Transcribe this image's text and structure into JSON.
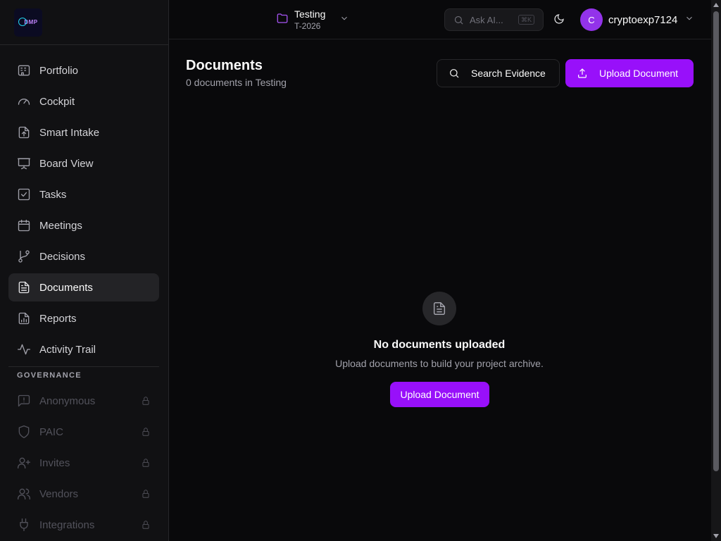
{
  "logo": {
    "text": "DMP"
  },
  "sidebar": {
    "items": [
      {
        "label": "Portfolio",
        "icon": "building-icon"
      },
      {
        "label": "Cockpit",
        "icon": "gauge-icon"
      },
      {
        "label": "Smart Intake",
        "icon": "file-upload-icon"
      },
      {
        "label": "Board View",
        "icon": "presentation-icon"
      },
      {
        "label": "Tasks",
        "icon": "checkbox-icon"
      },
      {
        "label": "Meetings",
        "icon": "calendar-icon"
      },
      {
        "label": "Decisions",
        "icon": "git-branch-icon"
      },
      {
        "label": "Documents",
        "icon": "document-icon",
        "active": true
      },
      {
        "label": "Reports",
        "icon": "report-icon"
      },
      {
        "label": "Activity Trail",
        "icon": "activity-icon"
      }
    ],
    "governance_label": "GOVERNANCE",
    "governance_items": [
      {
        "label": "Anonymous",
        "icon": "message-alert-icon",
        "locked": true
      },
      {
        "label": "PAIC",
        "icon": "shield-icon",
        "locked": true
      },
      {
        "label": "Invites",
        "icon": "user-plus-icon",
        "locked": true
      },
      {
        "label": "Vendors",
        "icon": "users-icon",
        "locked": true
      },
      {
        "label": "Integrations",
        "icon": "plug-icon",
        "locked": true
      }
    ]
  },
  "header": {
    "project_name": "Testing",
    "project_code": "T-2026",
    "ask_ai_placeholder": "Ask AI...",
    "ask_ai_shortcut": "⌘K",
    "username": "cryptoexp7124",
    "avatar_initial": "C"
  },
  "main": {
    "title": "Documents",
    "subtitle": "0 documents in Testing",
    "search_button": "Search Evidence",
    "upload_button": "Upload Document",
    "empty_title": "No documents uploaded",
    "empty_description": "Upload documents to build your project archive.",
    "empty_button": "Upload Document"
  },
  "colors": {
    "accent": "#9810fa",
    "background": "#09090b",
    "sidebar": "#111113"
  }
}
